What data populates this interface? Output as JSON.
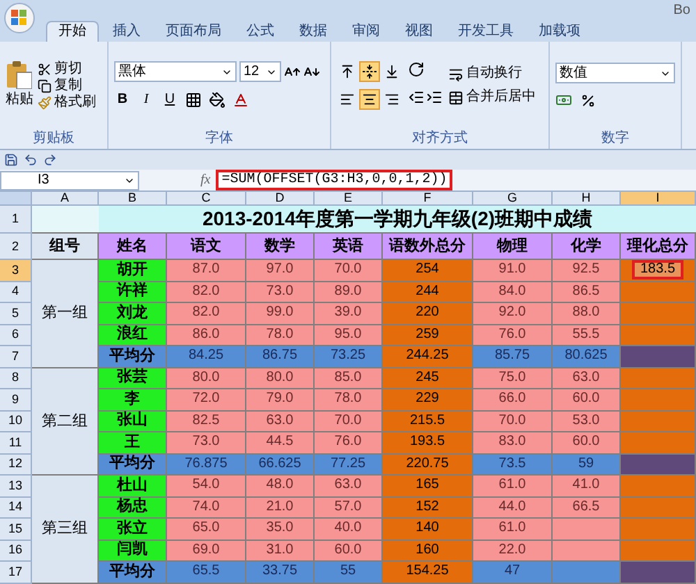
{
  "title_bar": {
    "text": "Bo"
  },
  "tabs": [
    {
      "label": "开始",
      "selected": true
    },
    {
      "label": "插入",
      "selected": false
    },
    {
      "label": "页面布局",
      "selected": false
    },
    {
      "label": "公式",
      "selected": false
    },
    {
      "label": "数据",
      "selected": false
    },
    {
      "label": "审阅",
      "selected": false
    },
    {
      "label": "视图",
      "selected": false
    },
    {
      "label": "开发工具",
      "selected": false
    },
    {
      "label": "加载项",
      "selected": false
    }
  ],
  "ribbon": {
    "clipboard": {
      "label": "剪贴板",
      "paste": "粘贴",
      "cut": "剪切",
      "copy": "复制",
      "format_painter": "格式刷"
    },
    "font": {
      "label": "字体",
      "font_name": "黑体",
      "font_size": "12",
      "bold": "B",
      "italic": "I",
      "underline": "U"
    },
    "alignment": {
      "label": "对齐方式",
      "vertical": [
        {
          "kind": "top",
          "selected": false
        },
        {
          "kind": "middle",
          "selected": true
        },
        {
          "kind": "bottom",
          "selected": false
        }
      ],
      "horizontal": [
        {
          "kind": "left",
          "selected": false
        },
        {
          "kind": "center",
          "selected": true
        },
        {
          "kind": "right",
          "selected": false
        }
      ],
      "wrap_text": "自动换行",
      "merge_center": "合并后居中"
    },
    "number": {
      "label": "数字",
      "format": "数值"
    }
  },
  "name_box": "I3",
  "function_label": "fx",
  "formula": {
    "text": "=SUM(OFFSET(G3:H3,0,0,1,2))",
    "highlighted": true
  },
  "columns": [
    {
      "label": "A",
      "selected": false
    },
    {
      "label": "B",
      "selected": false
    },
    {
      "label": "C",
      "selected": false
    },
    {
      "label": "D",
      "selected": false
    },
    {
      "label": "E",
      "selected": false
    },
    {
      "label": "F",
      "selected": false
    },
    {
      "label": "G",
      "selected": false
    },
    {
      "label": "H",
      "selected": false
    },
    {
      "label": "I",
      "selected": true
    }
  ],
  "row_numbers": [
    {
      "label": "1",
      "selected": false
    },
    {
      "label": "2",
      "selected": false
    },
    {
      "label": "3",
      "selected": true
    },
    {
      "label": "4",
      "selected": false
    },
    {
      "label": "5",
      "selected": false
    },
    {
      "label": "6",
      "selected": false
    },
    {
      "label": "7",
      "selected": false
    },
    {
      "label": "8",
      "selected": false
    },
    {
      "label": "9",
      "selected": false
    },
    {
      "label": "10",
      "selected": false
    },
    {
      "label": "11",
      "selected": false
    },
    {
      "label": "12",
      "selected": false
    },
    {
      "label": "13",
      "selected": false
    },
    {
      "label": "14",
      "selected": false
    },
    {
      "label": "15",
      "selected": false
    },
    {
      "label": "16",
      "selected": false
    },
    {
      "label": "17",
      "selected": false
    }
  ],
  "sheet_title": "2013-2014年度第一学期九年级(2)班期中成绩",
  "headers": [
    "组号",
    "姓名",
    "语文",
    "数学",
    "英语",
    "语数外总分",
    "物理",
    "化学",
    "理化总分"
  ],
  "groups": [
    {
      "label": "第一组",
      "rows": [
        {
          "kind": "student",
          "cells": [
            "胡开",
            "87.0",
            "97.0",
            "70.0",
            "254",
            "91.0",
            "92.5"
          ],
          "result": {
            "text": "183.5",
            "highlighted": true
          }
        },
        {
          "kind": "student",
          "cells": [
            "许祥",
            "82.0",
            "73.0",
            "89.0",
            "244",
            "84.0",
            "86.5"
          ]
        },
        {
          "kind": "student",
          "cells": [
            "刘龙",
            "82.0",
            "99.0",
            "39.0",
            "220",
            "92.0",
            "88.0"
          ]
        },
        {
          "kind": "student",
          "cells": [
            "浪红",
            "86.0",
            "78.0",
            "95.0",
            "259",
            "76.0",
            "55.5"
          ]
        },
        {
          "kind": "average",
          "cells": [
            "平均分",
            "84.25",
            "86.75",
            "73.25",
            "244.25",
            "85.75",
            "80.625"
          ]
        }
      ]
    },
    {
      "label": "第二组",
      "rows": [
        {
          "kind": "student",
          "cells": [
            "张芸",
            "80.0",
            "80.0",
            "85.0",
            "245",
            "75.0",
            "63.0"
          ]
        },
        {
          "kind": "student",
          "cells": [
            "李",
            "72.0",
            "79.0",
            "78.0",
            "229",
            "66.0",
            "60.0"
          ]
        },
        {
          "kind": "student",
          "cells": [
            "张山",
            "82.5",
            "63.0",
            "70.0",
            "215.5",
            "70.0",
            "53.0"
          ]
        },
        {
          "kind": "student",
          "cells": [
            "王",
            "73.0",
            "44.5",
            "76.0",
            "193.5",
            "83.0",
            "60.0"
          ]
        },
        {
          "kind": "average",
          "cells": [
            "平均分",
            "76.875",
            "66.625",
            "77.25",
            "220.75",
            "73.5",
            "59"
          ]
        }
      ]
    },
    {
      "label": "第三组",
      "rows": [
        {
          "kind": "student",
          "cells": [
            "杜山",
            "54.0",
            "48.0",
            "63.0",
            "165",
            "61.0",
            "41.0"
          ]
        },
        {
          "kind": "student",
          "cells": [
            "杨忠",
            "74.0",
            "21.0",
            "57.0",
            "152",
            "44.0",
            "66.5"
          ]
        },
        {
          "kind": "student",
          "cells": [
            "张立",
            "65.0",
            "35.0",
            "40.0",
            "140",
            "61.0",
            null
          ]
        },
        {
          "kind": "student",
          "cells": [
            "闫凯",
            "69.0",
            "31.0",
            "60.0",
            "160",
            "22.0",
            null
          ]
        },
        {
          "kind": "average",
          "cells": [
            "平均分",
            "65.5",
            "33.75",
            "55",
            "154.25",
            "47",
            null
          ]
        }
      ]
    }
  ]
}
